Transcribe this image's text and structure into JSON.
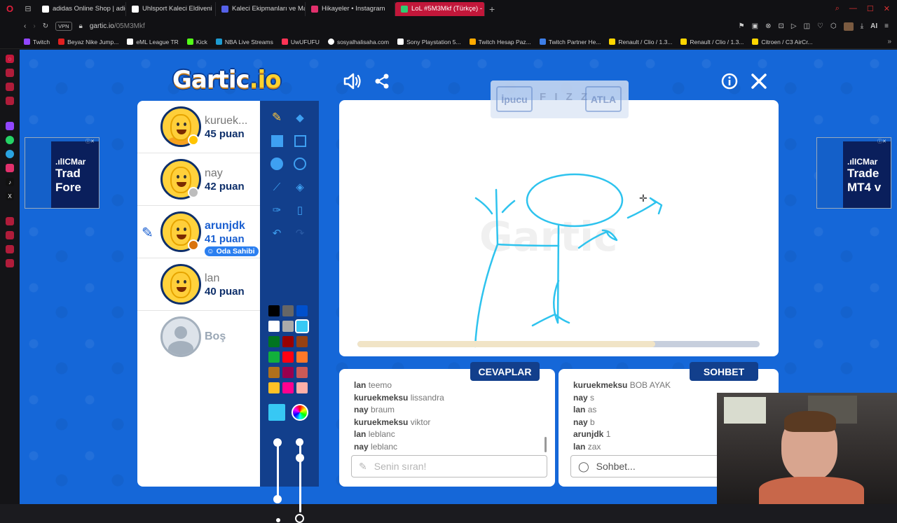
{
  "browser": {
    "tabs": [
      {
        "title": "adidas Online Shop | adida",
        "color": "#ffffff"
      },
      {
        "title": "Uhlsport Kaleci Eldiveni",
        "color": "#ffffff"
      },
      {
        "title": "Kaleci Ekipmanları ve Mal",
        "color": "#5561e8"
      },
      {
        "title": "Hikayeler • Instagram",
        "color": "#e1306c"
      },
      {
        "title": "LoL #5M3Mkf (Türkçe) - G",
        "color": "#2ecc71"
      }
    ],
    "vpn": "VPN",
    "url_domain": "gartic.io",
    "url_path": "/05M3Mkf",
    "bookmarks": [
      {
        "label": "Twitch",
        "color": "#9146ff"
      },
      {
        "label": "Beyaz Nike Jump...",
        "color": "#e02020"
      },
      {
        "label": "eML League TR",
        "color": "#ffffff"
      },
      {
        "label": "Kick",
        "color": "#53fc18"
      },
      {
        "label": "NBA Live Streams",
        "color": "#1d9bd1"
      },
      {
        "label": "UwUFUFU",
        "color": "#ff3355"
      },
      {
        "label": "sosyalhalisaha.com",
        "color": "#ffffff"
      },
      {
        "label": "Sony Playstation 5...",
        "color": "#ffffff"
      },
      {
        "label": "Twitch Hesap Paz...",
        "color": "#ffaa00"
      },
      {
        "label": "Twitch Partner He...",
        "color": "#3d7ee8"
      },
      {
        "label": "Renault / Clio / 1.3...",
        "color": "#ffd600"
      },
      {
        "label": "Renault / Clio / 1.3...",
        "color": "#ffd600"
      },
      {
        "label": "Citroen / C3 AirCr...",
        "color": "#ffd600"
      }
    ],
    "addr_right": "AI"
  },
  "game": {
    "logo_main": "Gartic",
    "logo_suffix": ".io",
    "players": [
      {
        "name": "kuruek...",
        "points": "45 puan",
        "badge_color": "#ffc400",
        "drawing": false
      },
      {
        "name": "nay",
        "points": "42 puan",
        "badge_color": "#bdbdbd",
        "drawing": false
      },
      {
        "name": "arunjdk",
        "points": "41 puan",
        "badge_color": "#d9730d",
        "drawing": true,
        "owner_label": "Oda Sahibi"
      },
      {
        "name": "lan",
        "points": "40 puan",
        "badge_color": "",
        "drawing": false
      }
    ],
    "empty_slot": "Boş",
    "hint": {
      "hint_label": "İpucu",
      "word": "F I Z Z",
      "skip_label": "ATLA"
    },
    "progress_fraction": 0.74,
    "answers_label": "CEVAPLAR",
    "chat_label": "SOHBET",
    "answers": [
      {
        "user": "lan",
        "text": "teemo"
      },
      {
        "user": "kuruekmeksu",
        "text": "lissandra"
      },
      {
        "user": "nay",
        "text": "braum"
      },
      {
        "user": "kuruekmeksu",
        "text": "viktor"
      },
      {
        "user": "lan",
        "text": "leblanc"
      },
      {
        "user": "nay",
        "text": "leblanc"
      }
    ],
    "chat": [
      {
        "user": "kuruekmeksu",
        "text": "BOB AYAK"
      },
      {
        "user": "nay",
        "text": "s"
      },
      {
        "user": "lan",
        "text": "as"
      },
      {
        "user": "nay",
        "text": "b"
      },
      {
        "user": "arunjdk",
        "text": "1"
      },
      {
        "user": "lan",
        "text": "zax"
      }
    ],
    "answer_placeholder": "Senin sıran!",
    "chat_placeholder": "Sohbet...",
    "palette": [
      "#000000",
      "#666666",
      "#0050cd",
      "#ffffff",
      "#aaaaaa",
      "#26c9ff",
      "#017420",
      "#990000",
      "#964112",
      "#11b03c",
      "#ff0013",
      "#ff7829",
      "#b0701c",
      "#99004e",
      "#cb5a57",
      "#ffc126",
      "#ff008f",
      "#feafa8"
    ],
    "selected_color": "#37c8f4",
    "ads": {
      "left_brand": ".ılICMar",
      "left_line1": "Trad",
      "left_line2": "Fore",
      "right_brand": ".ılICMar",
      "right_line1": "Trade",
      "right_line2": "MT4 v"
    }
  }
}
